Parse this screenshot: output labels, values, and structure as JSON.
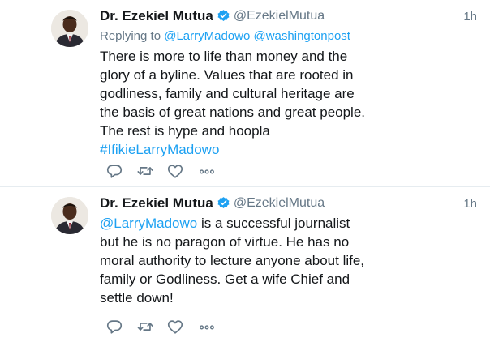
{
  "tweets": [
    {
      "author": {
        "name": "Dr. Ezekiel Mutua",
        "handle": "@EzekielMutua",
        "verified": true
      },
      "time": "1h",
      "reply": {
        "prefix": "Replying to",
        "mentions": [
          "@LarryMadowo",
          "@washingtonpost"
        ]
      },
      "lines": [
        "There is more to life than money and the",
        "glory of a byline. Values that are rooted in",
        "godliness, family and cultural heritage are",
        "the basis of great nations and great people.",
        "The rest is hype and hoopla"
      ],
      "hashtag": "#IfikieLarryMadowo",
      "actions": [
        "reply-icon",
        "retweet-icon",
        "like-icon",
        "more-icon"
      ]
    },
    {
      "author": {
        "name": "Dr. Ezekiel Mutua",
        "handle": "@EzekielMutua",
        "verified": true
      },
      "time": "1h",
      "first_line": {
        "mention": "@LarryMadowo",
        "rest": " is a successful journalist"
      },
      "lines": [
        "but he is no paragon of virtue. He has no",
        "moral authority to lecture anyone about life,",
        "family or Godliness. Get a wife Chief and",
        "settle down!"
      ],
      "actions": [
        "reply-icon",
        "retweet-icon",
        "like-icon",
        "more-icon"
      ]
    }
  ],
  "colors": {
    "text": "#14171a",
    "muted": "#657786",
    "link": "#1da1f2",
    "verified": "#1da1f2",
    "icon": "#657786",
    "divider": "#e6ecf0"
  }
}
